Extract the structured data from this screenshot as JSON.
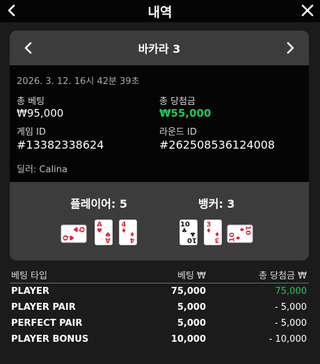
{
  "header": {
    "title": "내역"
  },
  "card": {
    "game_title": "바카라 3",
    "datetime": "2026. 3. 12. 16시 42분 39초",
    "total_bet_label": "총 베팅",
    "total_bet_value": "₩95,000",
    "total_win_label": "총 당첨금",
    "total_win_value": "₩55,000",
    "game_id_label": "게임 ID",
    "game_id_value": "#13382338624",
    "round_id_label": "라운드 ID",
    "round_id_value": "#262508536124008",
    "dealer": "딜러: Calina"
  },
  "result": {
    "player_score": "플레이어: 5",
    "banker_score": "뱅커: 3",
    "player_cards": [
      {
        "rank": "Q",
        "suit": "♥",
        "color": "#e0263a",
        "rotated": true
      },
      {
        "rank": "A",
        "suit": "♥",
        "color": "#e0263a",
        "rotated": false
      },
      {
        "rank": "4",
        "suit": "♦",
        "color": "#e0263a",
        "rotated": false
      }
    ],
    "banker_cards": [
      {
        "rank": "10",
        "suit": "♣",
        "color": "#111111",
        "rotated": false
      },
      {
        "rank": "3",
        "suit": "♦",
        "color": "#e0263a",
        "rotated": false
      },
      {
        "rank": "10",
        "suit": "♦",
        "color": "#e0263a",
        "rotated": true
      }
    ]
  },
  "bets": {
    "headers": {
      "type": "베팅 타입",
      "bet": "베팅 ₩",
      "win": "총 당첨금 ₩"
    },
    "rows": [
      {
        "type": "PLAYER",
        "bet": "75,000",
        "win": "75,000",
        "win_status": "positive"
      },
      {
        "type": "PLAYER PAIR",
        "bet": "5,000",
        "win": "- 5,000",
        "win_status": "negative"
      },
      {
        "type": "PERFECT PAIR",
        "bet": "5,000",
        "win": "- 5,000",
        "win_status": "negative"
      },
      {
        "type": "PLAYER BONUS",
        "bet": "10,000",
        "win": "- 10,000",
        "win_status": "negative"
      }
    ]
  },
  "colors": {
    "accent_green": "#19c95a",
    "card_red": "#e0263a",
    "background": "#1b1b1b",
    "panel": "#3c3c3c"
  }
}
